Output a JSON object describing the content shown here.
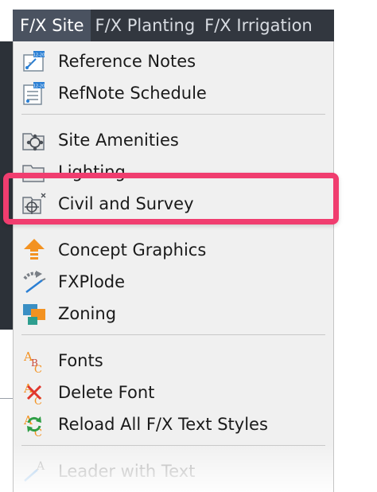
{
  "menubar": {
    "items": [
      {
        "label": "F/X Site",
        "active": true
      },
      {
        "label": "F/X Planting",
        "active": false
      },
      {
        "label": "F/X Irrigation",
        "active": false
      }
    ]
  },
  "dropdown": {
    "items": [
      {
        "label": "Reference Notes",
        "icon": "reference-notes-icon"
      },
      {
        "label": "RefNote Schedule",
        "icon": "refnote-schedule-icon"
      },
      {
        "label": "Site Amenities",
        "icon": "site-amenities-icon"
      },
      {
        "label": "Lighting",
        "icon": "lighting-icon"
      },
      {
        "label": "Civil and Survey",
        "icon": "civil-survey-icon",
        "highlighted": true
      },
      {
        "label": "Concept Graphics",
        "icon": "concept-graphics-icon"
      },
      {
        "label": "FXPlode",
        "icon": "fxplode-icon"
      },
      {
        "label": "Zoning",
        "icon": "zoning-icon"
      },
      {
        "label": "Fonts",
        "icon": "fonts-icon"
      },
      {
        "label": "Delete Font",
        "icon": "delete-font-icon"
      },
      {
        "label": "Reload All F/X Text Styles",
        "icon": "reload-text-styles-icon"
      },
      {
        "label": "Leader with Text",
        "icon": "leader-with-text-icon",
        "disabled": true
      }
    ]
  },
  "colors": {
    "menubar_bg": "#32373f",
    "menubar_active": "#4a5260",
    "dropdown_bg": "#f0f0f0",
    "highlight": "#f03d6f",
    "icon_blue": "#2a7fd4",
    "icon_orange": "#f39221"
  }
}
